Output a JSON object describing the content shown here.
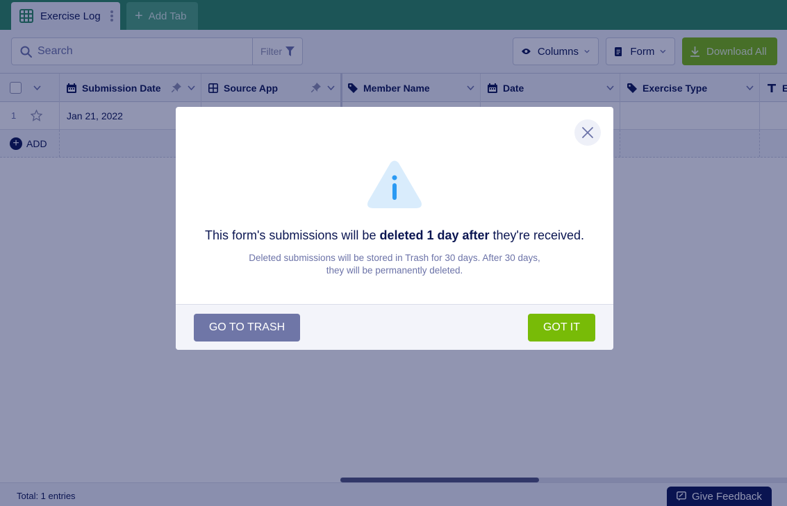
{
  "tabs": [
    {
      "label": "Exercise Log",
      "icon": "grid-icon",
      "active": true
    },
    {
      "label": "Add Tab",
      "icon": "plus-icon",
      "active": false
    }
  ],
  "toolbar": {
    "search_placeholder": "Search",
    "filter_label": "Filter",
    "columns_label": "Columns",
    "form_label": "Form",
    "download_label": "Download All"
  },
  "columns": [
    {
      "label": "Submission Date",
      "icon": "calendar-icon",
      "pinned": true
    },
    {
      "label": "Source App",
      "icon": "grid-icon",
      "pinned": true
    },
    {
      "label": "Member Name",
      "icon": "tag-icon"
    },
    {
      "label": "Date",
      "icon": "calendar-icon"
    },
    {
      "label": "Exercise Type",
      "icon": "tag-icon"
    },
    {
      "label": "E",
      "icon": "text-icon"
    }
  ],
  "rows": [
    {
      "number": "1",
      "submission_date": "Jan 21, 2022"
    }
  ],
  "add_row_label": "ADD",
  "footer": {
    "total": "Total: 1 entries",
    "feedback_label": "Give Feedback"
  },
  "modal": {
    "msg_prefix": "This form's submissions will be ",
    "msg_bold": "deleted 1 day after",
    "msg_suffix": " they're received.",
    "sub_line1": "Deleted submissions will be stored in Trash for 30 days. After 30 days,",
    "sub_line2": "they will be permanently deleted.",
    "trash_label": "GO TO TRASH",
    "got_label": "GOT IT"
  },
  "colors": {
    "brand_green": "#2a8a5c",
    "accent_green": "#78bb07",
    "navy": "#0a1551",
    "muted_button": "#6f76a7",
    "info_blue": "#2b9af3"
  }
}
